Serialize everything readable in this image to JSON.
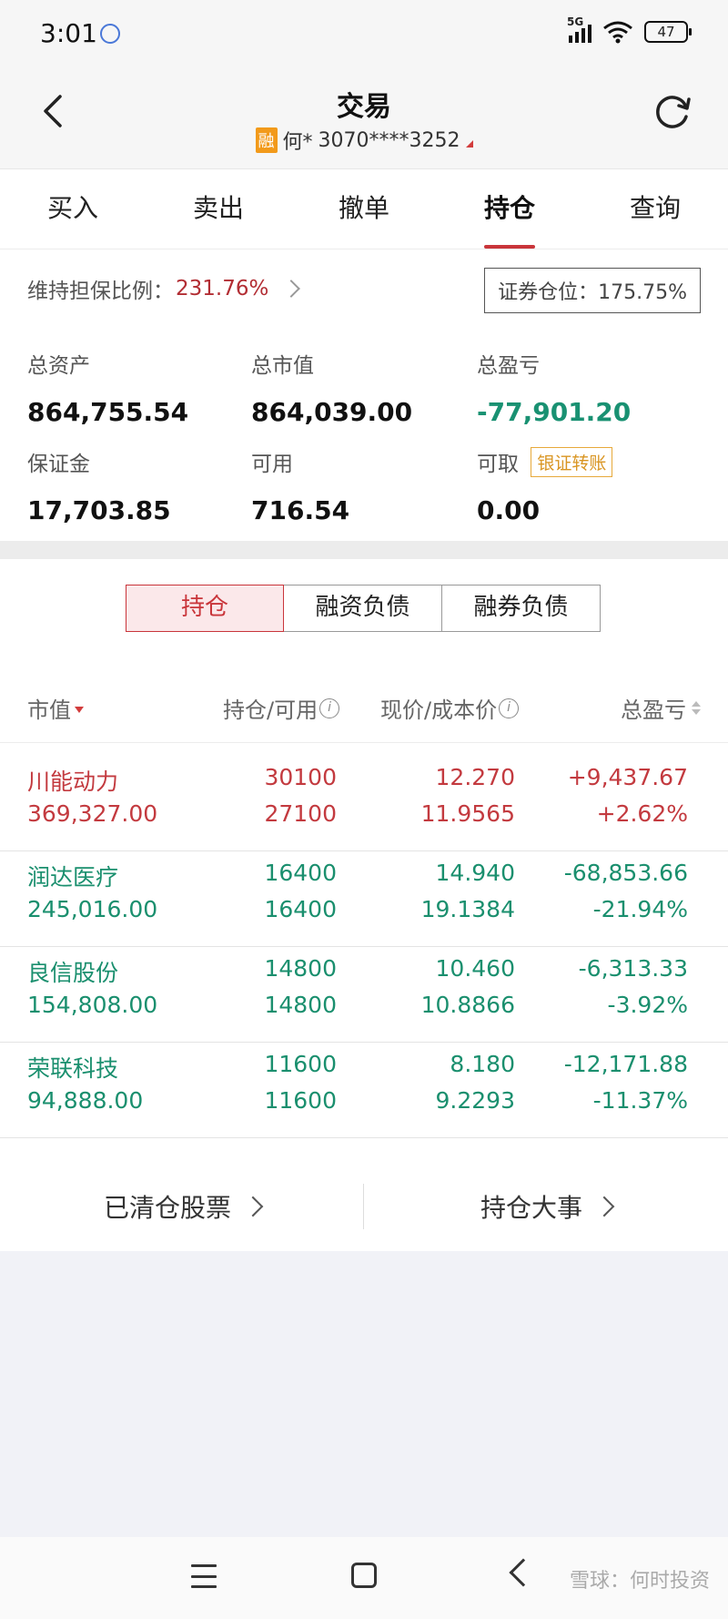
{
  "status_bar": {
    "time": "3:01",
    "network": "5G",
    "battery": "47"
  },
  "header": {
    "title": "交易",
    "account_badge": "融",
    "account_name": "何*",
    "account_number": "3070****3252"
  },
  "tabs": [
    {
      "label": "买入",
      "active": false
    },
    {
      "label": "卖出",
      "active": false
    },
    {
      "label": "撤单",
      "active": false
    },
    {
      "label": "持仓",
      "active": true
    },
    {
      "label": "查询",
      "active": false
    }
  ],
  "summary": {
    "maintenance_ratio_label": "维持担保比例：",
    "maintenance_ratio_value": "231.76%",
    "position_label": "证券仓位：175.75%",
    "total_assets_label": "总资产",
    "total_assets": "864,755.54",
    "market_value_label": "总市值",
    "market_value": "864,039.00",
    "total_pl_label": "总盈亏",
    "total_pl": "-77,901.20",
    "margin_label": "保证金",
    "margin": "17,703.85",
    "available_label": "可用",
    "available": "716.54",
    "withdrawable_label": "可取",
    "transfer_label": "银证转账",
    "withdrawable": "0.00"
  },
  "segments": [
    "持仓",
    "融资负债",
    "融券负债"
  ],
  "table": {
    "headers": {
      "market_value": "市值",
      "qty": "持仓/可用",
      "price": "现价/成本价",
      "pl": "总盈亏"
    },
    "rows": [
      {
        "name": "川能动力",
        "market_value": "369,327.00",
        "qty": "30100",
        "avail": "27100",
        "price": "12.270",
        "cost": "11.9565",
        "pl": "+9,437.67",
        "pl_pct": "+2.62%",
        "color": "red"
      },
      {
        "name": "润达医疗",
        "market_value": "245,016.00",
        "qty": "16400",
        "avail": "16400",
        "price": "14.940",
        "cost": "19.1384",
        "pl": "-68,853.66",
        "pl_pct": "-21.94%",
        "color": "green"
      },
      {
        "name": "良信股份",
        "market_value": "154,808.00",
        "qty": "14800",
        "avail": "14800",
        "price": "10.460",
        "cost": "10.8866",
        "pl": "-6,313.33",
        "pl_pct": "-3.92%",
        "color": "green"
      },
      {
        "name": "荣联科技",
        "market_value": "94,888.00",
        "qty": "11600",
        "avail": "11600",
        "price": "8.180",
        "cost": "9.2293",
        "pl": "-12,171.88",
        "pl_pct": "-11.37%",
        "color": "green"
      }
    ]
  },
  "footer_links": {
    "cleared": "已清仓股票",
    "events": "持仓大事"
  },
  "watermark": "雪球：何时投资",
  "colors": {
    "accent_red": "#c9353a",
    "loss_green": "#1a8f6e",
    "badge_orange": "#f29a1a"
  }
}
